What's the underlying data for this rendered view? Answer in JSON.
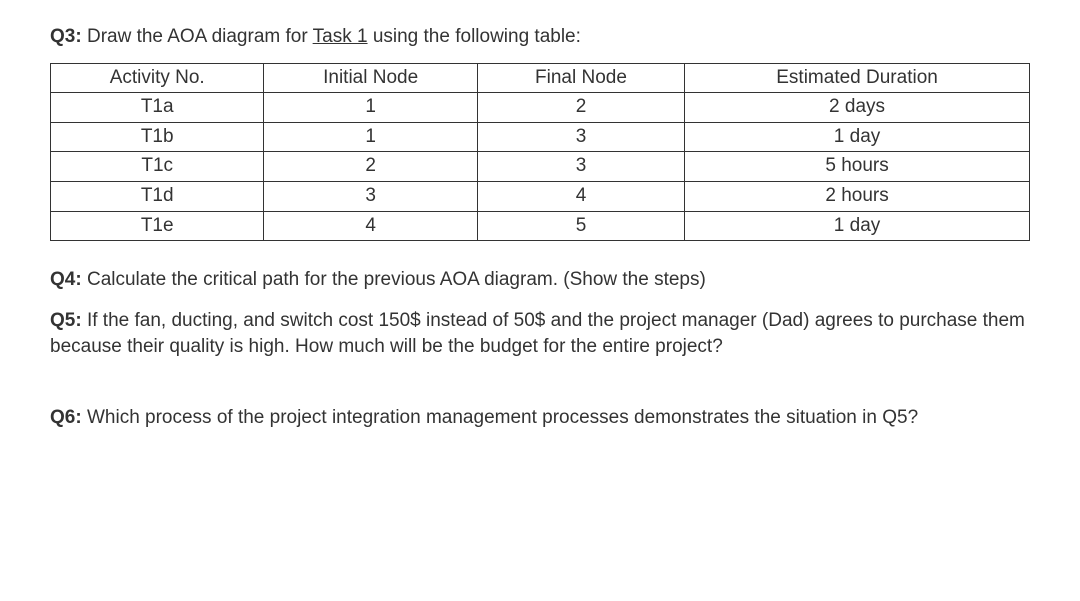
{
  "q3": {
    "label": "Q3:",
    "text_before": " Draw the AOA diagram for ",
    "task_link": "Task 1",
    "text_after": " using the following table:",
    "table": {
      "headers": [
        "Activity No.",
        "Initial Node",
        "Final Node",
        "Estimated Duration"
      ],
      "rows": [
        [
          "T1a",
          "1",
          "2",
          "2 days"
        ],
        [
          "T1b",
          "1",
          "3",
          "1 day"
        ],
        [
          "T1c",
          "2",
          "3",
          "5 hours"
        ],
        [
          "T1d",
          "3",
          "4",
          "2 hours"
        ],
        [
          "T1e",
          "4",
          "5",
          "1 day"
        ]
      ]
    }
  },
  "q4": {
    "label": "Q4:",
    "text": " Calculate the critical path for the previous AOA diagram. (Show the steps)"
  },
  "q5": {
    "label": "Q5:",
    "text": " If the fan, ducting, and switch cost 150$ instead of 50$ and the project manager (Dad) agrees to purchase them because their quality is high. How much will be the budget for the entire project?"
  },
  "q6": {
    "label": "Q6:",
    "text": " Which process of the project integration management processes demonstrates the situation in Q5?"
  }
}
